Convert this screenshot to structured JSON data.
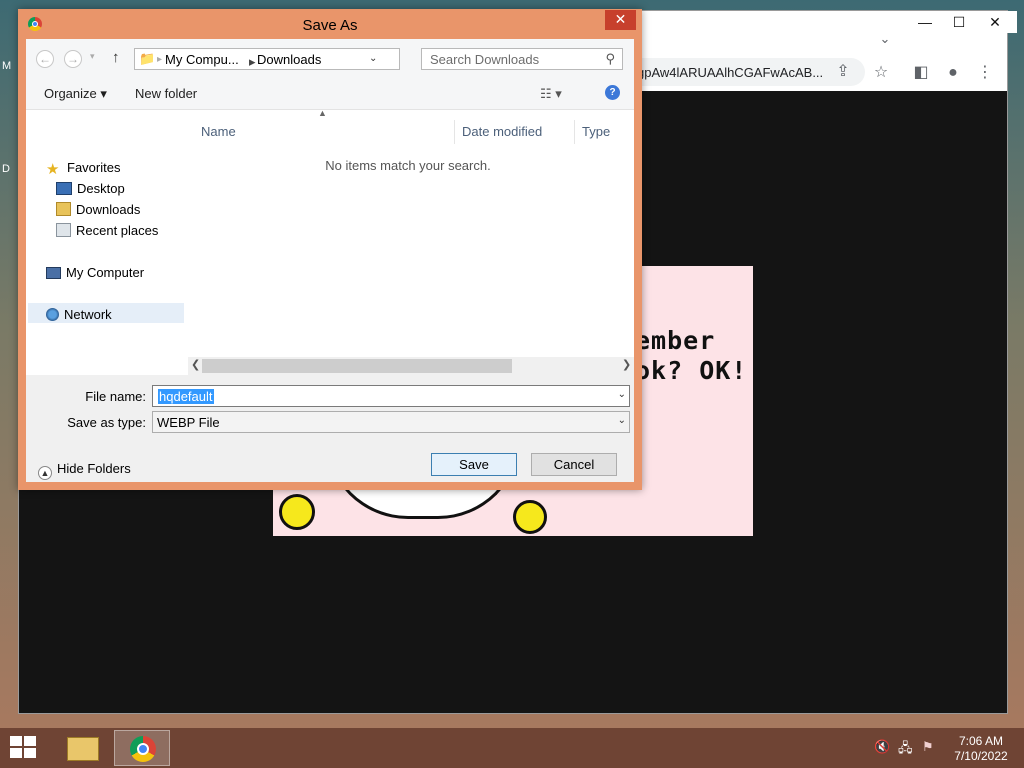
{
  "chrome": {
    "url_text": "gpAw4lARUAAlhCGAFwAcAB...",
    "image_text_line1": "ember",
    "image_text_line2": "ok? OK!"
  },
  "dialog": {
    "title": "Save As",
    "close_glyph": "✕",
    "nav": {
      "back_glyph": "←",
      "forward_glyph": "→",
      "up_glyph": "↑",
      "breadcrumb": [
        "My Compu...",
        "Downloads"
      ],
      "breadcrumb_sep": "▸",
      "refresh_glyph": "↻",
      "search_placeholder": "Search Downloads"
    },
    "commands": {
      "organize": "Organize ▾",
      "new_folder": "New folder",
      "view_glyph": "☷ ▾",
      "help_glyph": "?"
    },
    "sidebar": {
      "favorites": "Favorites",
      "desktop": "Desktop",
      "downloads": "Downloads",
      "recent": "Recent places",
      "my_computer": "My Computer",
      "network": "Network"
    },
    "columns": {
      "name": "Name",
      "date": "Date modified",
      "type": "Type"
    },
    "empty_message": "No items match your search.",
    "file_name_label": "File name:",
    "file_name_value": "hqdefault",
    "save_type_label": "Save as type:",
    "save_type_value": "WEBP File",
    "hide_folders": "Hide Folders",
    "save_button": "Save",
    "cancel_button": "Cancel"
  },
  "taskbar": {
    "time": "7:06 AM",
    "date": "7/10/2022"
  },
  "colors": {
    "dialog_frame": "#e9956a",
    "close_red": "#c7402c",
    "selection_blue": "#3399ff",
    "taskbar": "#6f4434"
  }
}
